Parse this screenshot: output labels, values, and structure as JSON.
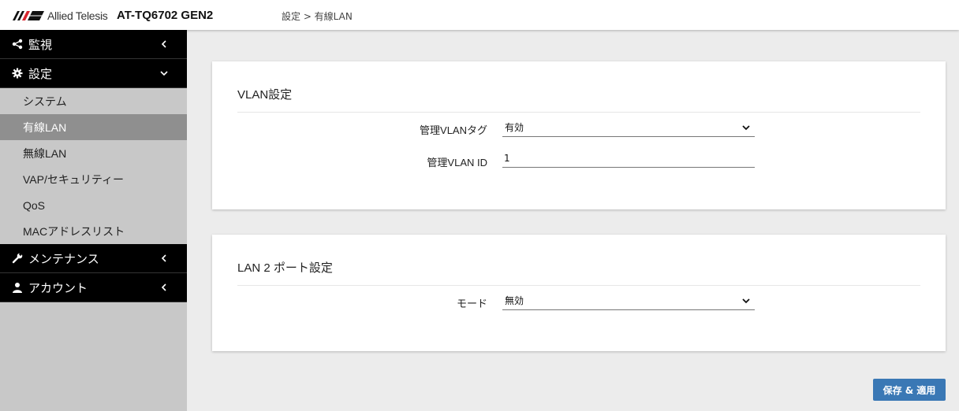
{
  "header": {
    "brand": "Allied Telesis",
    "model": "AT-TQ6702 GEN2",
    "breadcrumb": "設定 > 有線LAN"
  },
  "sidebar": {
    "groups": [
      {
        "label": "監視",
        "icon": "share-icon",
        "chevron": "chevron-left-icon"
      },
      {
        "label": "設定",
        "icon": "gear-icon",
        "chevron": "chevron-down-icon"
      },
      {
        "label": "メンテナンス",
        "icon": "wrench-icon",
        "chevron": "chevron-left-icon"
      },
      {
        "label": "アカウント",
        "icon": "user-icon",
        "chevron": "chevron-left-icon"
      }
    ],
    "settings_items": [
      "システム",
      "有線LAN",
      "無線LAN",
      "VAP/セキュリティー",
      "QoS",
      "MACアドレスリスト"
    ],
    "active_item": "有線LAN"
  },
  "vlan_card": {
    "title": "VLAN設定",
    "tag_label": "管理VLANタグ",
    "tag_value": "有効",
    "id_label": "管理VLAN ID",
    "id_value": "1"
  },
  "lan2_card": {
    "title": "LAN 2 ポート設定",
    "mode_label": "モード",
    "mode_value": "無効"
  },
  "actions": {
    "save_label": "保存 & 適用"
  },
  "colors": {
    "accent_button": "#3a78b5",
    "brand_red": "#d8262f",
    "sidebar_black": "#000000",
    "active_item": "#8f8f8f"
  }
}
